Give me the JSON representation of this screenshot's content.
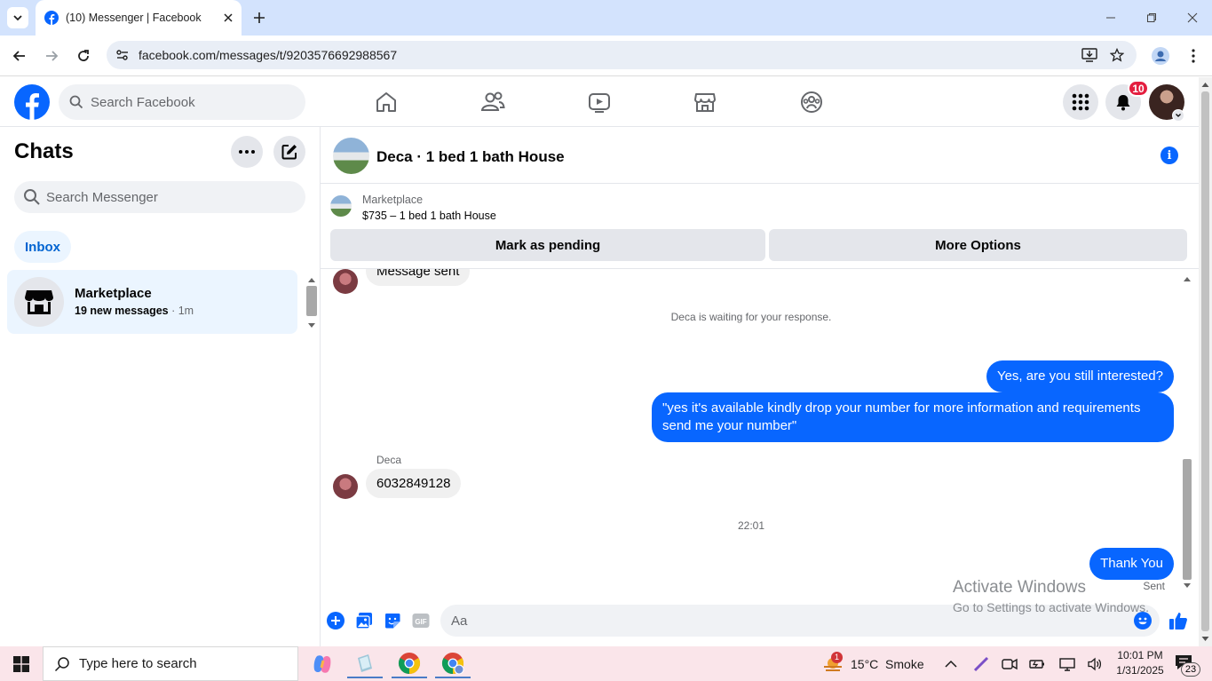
{
  "browser": {
    "tab_title": "(10) Messenger | Facebook",
    "url": "facebook.com/messages/t/9203576692988567"
  },
  "facebook": {
    "search_placeholder": "Search Facebook",
    "notification_count": "10"
  },
  "sidebar": {
    "title": "Chats",
    "search_placeholder": "Search Messenger",
    "filter_label": "Inbox",
    "conversations": [
      {
        "name": "Marketplace",
        "preview": "19 new messages",
        "time": " · 1m"
      }
    ]
  },
  "chat": {
    "title": "Deca · 1 bed 1 bath House",
    "marketplace_label": "Marketplace",
    "listing": "$735 – 1 bed 1 bath House",
    "buttons": {
      "pending": "Mark as pending",
      "more": "More Options"
    },
    "messages": {
      "cut_off_incoming": "Message sent",
      "system_notice": "Deca is waiting for your response.",
      "out_1": "Yes, are you still interested?",
      "out_2": "\"yes it's available kindly drop your number for more information and requirements send me your number\"",
      "sender_name": "Deca",
      "in_1": "6032849128",
      "timestamp": "22:01",
      "out_3": "Thank You",
      "status": "Sent"
    },
    "composer_placeholder": "Aa"
  },
  "watermark": {
    "line1": "Activate Windows",
    "line2": "Go to Settings to activate Windows."
  },
  "taskbar": {
    "search_placeholder": "Type here to search",
    "weather": "15°C  Smoke",
    "weather_badge": "1",
    "time": "10:01 PM",
    "date": "1/31/2025",
    "notification_count": "23"
  },
  "colors": {
    "accent": "#0866ff",
    "tab_bar": "#d3e3fd",
    "badge": "#e41e3f",
    "taskbar": "#fae5ea"
  }
}
